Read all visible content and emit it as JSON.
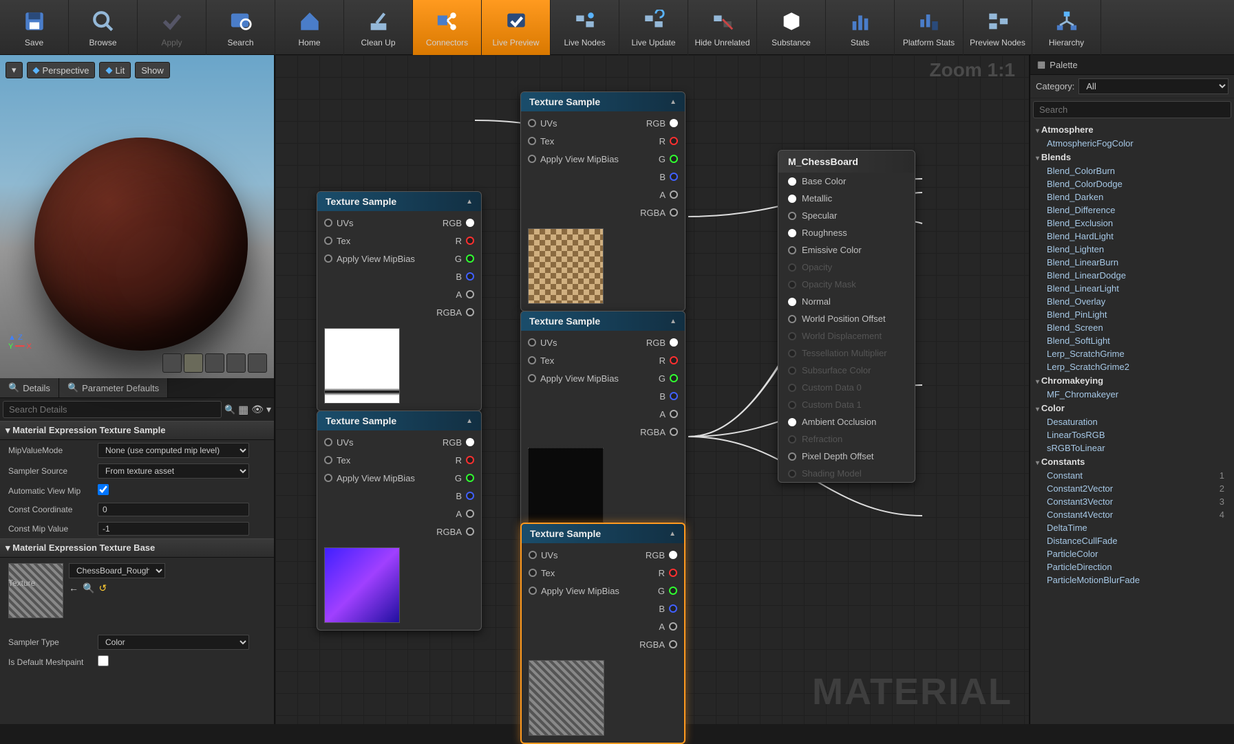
{
  "toolbar": [
    {
      "id": "save",
      "label": "Save",
      "active": false
    },
    {
      "id": "browse",
      "label": "Browse",
      "active": false
    },
    {
      "id": "apply",
      "label": "Apply",
      "active": false,
      "disabled": true
    },
    {
      "id": "search",
      "label": "Search",
      "active": false
    },
    {
      "id": "home",
      "label": "Home",
      "active": false
    },
    {
      "id": "cleanup",
      "label": "Clean Up",
      "active": false
    },
    {
      "id": "connectors",
      "label": "Connectors",
      "active": true
    },
    {
      "id": "livepreview",
      "label": "Live Preview",
      "active": true
    },
    {
      "id": "livenodes",
      "label": "Live Nodes",
      "active": false
    },
    {
      "id": "liveupdate",
      "label": "Live Update",
      "active": false
    },
    {
      "id": "hideunrelated",
      "label": "Hide Unrelated",
      "active": false
    },
    {
      "id": "substance",
      "label": "Substance",
      "active": false
    },
    {
      "id": "stats",
      "label": "Stats",
      "active": false
    },
    {
      "id": "platformstats",
      "label": "Platform Stats",
      "active": false
    },
    {
      "id": "previewnodes",
      "label": "Preview Nodes",
      "active": false
    },
    {
      "id": "hierarchy",
      "label": "Hierarchy",
      "active": false
    }
  ],
  "viewport": {
    "perspective_label": "Perspective",
    "lit_label": "Lit",
    "show_label": "Show"
  },
  "tabs": {
    "details": "Details",
    "param": "Parameter Defaults"
  },
  "search_details_placeholder": "Search Details",
  "details": {
    "section1": "Material Expression Texture Sample",
    "mipvaluemode_label": "MipValueMode",
    "mipvaluemode_value": "None (use computed mip level)",
    "samplersource_label": "Sampler Source",
    "samplersource_value": "From texture asset",
    "autoviewmip_label": "Automatic View Mip",
    "constcoord_label": "Const Coordinate",
    "constcoord_value": "0",
    "constmip_label": "Const Mip Value",
    "constmip_value": "-1",
    "section2": "Material Expression Texture Base",
    "texture_label": "Texture",
    "texture_value": "ChessBoard_Rough",
    "samplertype_label": "Sampler Type",
    "samplertype_value": "Color",
    "isdefault_label": "Is Default Meshpaint"
  },
  "graph": {
    "zoom": "Zoom 1:1",
    "watermark": "MATERIAL",
    "tex_sample_title": "Texture Sample",
    "material_name": "M_ChessBoard",
    "pins_in": [
      "UVs",
      "Tex",
      "Apply View MipBias"
    ],
    "pins_out": [
      "RGB",
      "R",
      "G",
      "B",
      "A",
      "RGBA"
    ],
    "mat_pins": [
      {
        "label": "Base Color",
        "on": true,
        "filled": true
      },
      {
        "label": "Metallic",
        "on": true,
        "filled": true
      },
      {
        "label": "Specular",
        "on": true,
        "filled": false
      },
      {
        "label": "Roughness",
        "on": true,
        "filled": true
      },
      {
        "label": "Emissive Color",
        "on": true,
        "filled": false
      },
      {
        "label": "Opacity",
        "on": false
      },
      {
        "label": "Opacity Mask",
        "on": false
      },
      {
        "label": "Normal",
        "on": true,
        "filled": true
      },
      {
        "label": "World Position Offset",
        "on": true,
        "filled": false
      },
      {
        "label": "World Displacement",
        "on": false
      },
      {
        "label": "Tessellation Multiplier",
        "on": false
      },
      {
        "label": "Subsurface Color",
        "on": false
      },
      {
        "label": "Custom Data 0",
        "on": false
      },
      {
        "label": "Custom Data 1",
        "on": false
      },
      {
        "label": "Ambient Occlusion",
        "on": true,
        "filled": true
      },
      {
        "label": "Refraction",
        "on": false
      },
      {
        "label": "Pixel Depth Offset",
        "on": true,
        "filled": false
      },
      {
        "label": "Shading Model",
        "on": false
      }
    ]
  },
  "palette": {
    "title": "Palette",
    "category_label": "Category:",
    "category_value": "All",
    "search_placeholder": "Search",
    "groups": [
      {
        "name": "Atmosphere",
        "items": [
          {
            "n": "AtmosphericFogColor"
          }
        ]
      },
      {
        "name": "Blends",
        "items": [
          {
            "n": "Blend_ColorBurn"
          },
          {
            "n": "Blend_ColorDodge"
          },
          {
            "n": "Blend_Darken"
          },
          {
            "n": "Blend_Difference"
          },
          {
            "n": "Blend_Exclusion"
          },
          {
            "n": "Blend_HardLight"
          },
          {
            "n": "Blend_Lighten"
          },
          {
            "n": "Blend_LinearBurn"
          },
          {
            "n": "Blend_LinearDodge"
          },
          {
            "n": "Blend_LinearLight"
          },
          {
            "n": "Blend_Overlay"
          },
          {
            "n": "Blend_PinLight"
          },
          {
            "n": "Blend_Screen"
          },
          {
            "n": "Blend_SoftLight"
          },
          {
            "n": "Lerp_ScratchGrime"
          },
          {
            "n": "Lerp_ScratchGrime2"
          }
        ]
      },
      {
        "name": "Chromakeying",
        "items": [
          {
            "n": "MF_Chromakeyer"
          }
        ]
      },
      {
        "name": "Color",
        "items": [
          {
            "n": "Desaturation"
          },
          {
            "n": "LinearTosRGB"
          },
          {
            "n": "sRGBToLinear"
          }
        ]
      },
      {
        "name": "Constants",
        "items": [
          {
            "n": "Constant",
            "s": "1"
          },
          {
            "n": "Constant2Vector",
            "s": "2"
          },
          {
            "n": "Constant3Vector",
            "s": "3"
          },
          {
            "n": "Constant4Vector",
            "s": "4"
          },
          {
            "n": "DeltaTime"
          },
          {
            "n": "DistanceCullFade"
          },
          {
            "n": "ParticleColor"
          },
          {
            "n": "ParticleDirection"
          },
          {
            "n": "ParticleMotionBlurFade"
          }
        ]
      }
    ]
  }
}
